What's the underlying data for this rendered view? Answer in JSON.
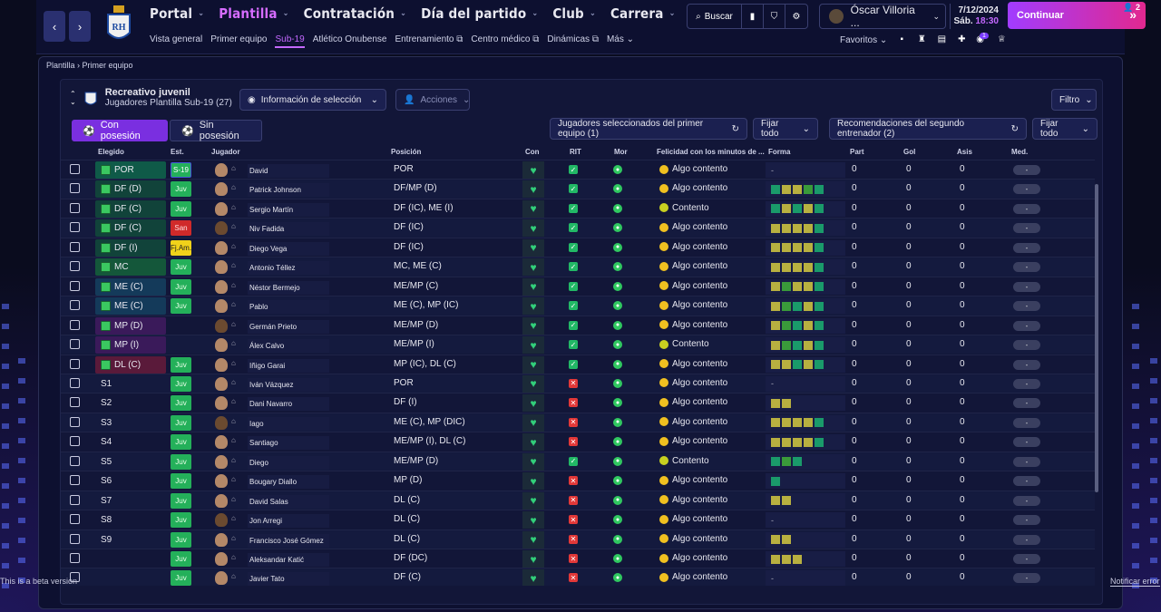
{
  "colors": {
    "accent": "#c468ff",
    "continue_from": "#a13cff",
    "continue_to": "#e2288f",
    "juv": "#24b05a",
    "san": "#d02a2a"
  },
  "nav": {
    "back_icon": "chevron-left-icon",
    "forward_icon": "chevron-right-icon",
    "main": [
      "Portal",
      "Plantilla",
      "Contratación",
      "Día del partido",
      "Club",
      "Carrera"
    ],
    "active_main": "Plantilla",
    "sub": [
      "Vista general",
      "Primer equipo",
      "Sub-19",
      "Atlético Onubense",
      "Entrenamiento",
      "Centro médico",
      "Dinámicas",
      "Más"
    ],
    "active_sub": "Sub-19"
  },
  "search": {
    "label": "Buscar"
  },
  "profile": {
    "name": "Óscar Villoria ..."
  },
  "date": {
    "date": "7/12/2024",
    "day": "Sáb.",
    "time": "18:30"
  },
  "continue": {
    "label": "Continuar",
    "count": "2"
  },
  "favs": {
    "label": "Favoritos",
    "badge": "1"
  },
  "breadcrumb": {
    "a": "Plantilla",
    "b": "Primer equipo"
  },
  "team": {
    "name": "Recreativo juvenil",
    "subtitle": "Jugadores Plantilla Sub-19 (27)"
  },
  "controls": {
    "info": "Información de selección",
    "actions": "Acciones",
    "filter": "Filtro",
    "tab_on": "Con posesión",
    "tab_off": "Sin posesión",
    "selected": "Jugadores seleccionados del primer equipo (1)",
    "fix_all": "Fijar todo",
    "recs": "Recomendaciones del segundo entrenador (2)",
    "fix_all2": "Fijar todo"
  },
  "columns": [
    "Elegido",
    "Est.",
    "Jugador",
    "Posición",
    "Con",
    "RIT",
    "Mor",
    "Felicidad con los minutos de ...",
    "Forma",
    "Part",
    "Gol",
    "Asis",
    "Med."
  ],
  "rows": [
    {
      "sel": "POR",
      "st": "S-19",
      "name": "David",
      "pos": "POR",
      "rit": "ok",
      "fel": "Algo contento",
      "forma": "-",
      "part": "0",
      "gol": "0",
      "asis": "0",
      "med": "-"
    },
    {
      "sel": "DF (D)",
      "st": "Juv",
      "name": "Patrick Johnson",
      "pos": "DF/MP (D)",
      "rit": "ok",
      "fel": "Algo contento",
      "forma": "gyyg g",
      "part": "0",
      "gol": "0",
      "asis": "0",
      "med": "-"
    },
    {
      "sel": "DF (C)",
      "st": "Juv",
      "name": "Sergio Martín",
      "pos": "DF (IC), ME (I)",
      "rit": "ok",
      "fel": "Contento",
      "forma": "gygyg",
      "part": "0",
      "gol": "0",
      "asis": "0",
      "med": "-"
    },
    {
      "sel": "DF (C)",
      "st": "San",
      "name": "Niv Fadida",
      "pos": "DF (IC)",
      "rit": "ok",
      "fel": "Algo contento",
      "forma": "yyyyg",
      "part": "0",
      "gol": "0",
      "asis": "0",
      "med": "-"
    },
    {
      "sel": "DF (I)",
      "st": "Fj.Am.",
      "name": "Diego Vega",
      "pos": "DF (IC)",
      "rit": "ok",
      "fel": "Algo contento",
      "forma": "yyyyg",
      "part": "0",
      "gol": "0",
      "asis": "0",
      "med": "-"
    },
    {
      "sel": "MC",
      "st": "Juv",
      "name": "Antonio Téllez",
      "pos": "MC, ME (C)",
      "rit": "ok",
      "fel": "Algo contento",
      "forma": "yyyyg",
      "part": "0",
      "gol": "0",
      "asis": "0",
      "med": "-"
    },
    {
      "sel": "ME (C)",
      "st": "Juv",
      "name": "Néstor Bermejo",
      "pos": "ME/MP (C)",
      "rit": "ok",
      "fel": "Algo contento",
      "forma": "ygyyg",
      "part": "0",
      "gol": "0",
      "asis": "0",
      "med": "-"
    },
    {
      "sel": "ME (C)",
      "st": "Juv",
      "name": "Pablo",
      "pos": "ME (C), MP (IC)",
      "rit": "ok",
      "fel": "Algo contento",
      "forma": "yggyg",
      "part": "0",
      "gol": "0",
      "asis": "0",
      "med": "-"
    },
    {
      "sel": "MP (D)",
      "st": "",
      "name": "Germán Prieto",
      "pos": "ME/MP (D)",
      "rit": "ok",
      "fel": "Algo contento",
      "forma": "yggyg",
      "part": "0",
      "gol": "0",
      "asis": "0",
      "med": "-"
    },
    {
      "sel": "MP (I)",
      "st": "",
      "name": "Álex Calvo",
      "pos": "ME/MP (I)",
      "rit": "ok",
      "fel": "Contento",
      "forma": "yggyg",
      "part": "0",
      "gol": "0",
      "asis": "0",
      "med": "-"
    },
    {
      "sel": "DL (C)",
      "st": "Juv",
      "name": "Iñigo Garai",
      "pos": "MP (IC), DL (C)",
      "rit": "ok",
      "fel": "Algo contento",
      "forma": "yygyg",
      "part": "0",
      "gol": "0",
      "asis": "0",
      "med": "-"
    },
    {
      "sel": "S1",
      "st": "Juv",
      "name": "Iván Vázquez",
      "pos": "POR",
      "rit": "no",
      "fel": "Algo contento",
      "forma": "-",
      "part": "0",
      "gol": "0",
      "asis": "0",
      "med": "-"
    },
    {
      "sel": "S2",
      "st": "Juv",
      "name": "Dani Navarro",
      "pos": "DF (I)",
      "rit": "no",
      "fel": "Algo contento",
      "forma": "yy",
      "part": "0",
      "gol": "0",
      "asis": "0",
      "med": "-"
    },
    {
      "sel": "S3",
      "st": "Juv",
      "name": "Iago",
      "pos": "ME (C), MP (DIC)",
      "rit": "no",
      "fel": "Algo contento",
      "forma": "yyyyg",
      "part": "0",
      "gol": "0",
      "asis": "0",
      "med": "-"
    },
    {
      "sel": "S4",
      "st": "Juv",
      "name": "Santiago",
      "pos": "ME/MP (I), DL (C)",
      "rit": "no",
      "fel": "Algo contento",
      "forma": "yyyyg",
      "part": "0",
      "gol": "0",
      "asis": "0",
      "med": "-"
    },
    {
      "sel": "S5",
      "st": "Juv",
      "name": "Diego",
      "pos": "ME/MP (D)",
      "rit": "ok",
      "fel": "Contento",
      "forma": "ggg",
      "part": "0",
      "gol": "0",
      "asis": "0",
      "med": "-"
    },
    {
      "sel": "S6",
      "st": "Juv",
      "name": "Bougary Diallo",
      "pos": "MP (D)",
      "rit": "no",
      "fel": "Algo contento",
      "forma": "g",
      "part": "0",
      "gol": "0",
      "asis": "0",
      "med": "-"
    },
    {
      "sel": "S7",
      "st": "Juv",
      "name": "David Salas",
      "pos": "DL (C)",
      "rit": "no",
      "fel": "Algo contento",
      "forma": "yy",
      "part": "0",
      "gol": "0",
      "asis": "0",
      "med": "-"
    },
    {
      "sel": "S8",
      "st": "Juv",
      "name": "Jon Arregi",
      "pos": "DL (C)",
      "rit": "no",
      "fel": "Algo contento",
      "forma": "-",
      "part": "0",
      "gol": "0",
      "asis": "0",
      "med": "-"
    },
    {
      "sel": "S9",
      "st": "Juv",
      "name": "Francisco José Gómez",
      "pos": "DL (C)",
      "rit": "no",
      "fel": "Algo contento",
      "forma": "yy",
      "part": "0",
      "gol": "0",
      "asis": "0",
      "med": "-"
    },
    {
      "sel": "",
      "st": "Juv",
      "name": "Aleksandar Katić",
      "pos": "DF (DC)",
      "rit": "no",
      "fel": "Algo contento",
      "forma": "yyy",
      "part": "0",
      "gol": "0",
      "asis": "0",
      "med": "-"
    },
    {
      "sel": "",
      "st": "Juv",
      "name": "Javier Tato",
      "pos": "DF (C)",
      "rit": "no",
      "fel": "Algo contento",
      "forma": "-",
      "part": "0",
      "gol": "0",
      "asis": "0",
      "med": "-"
    }
  ],
  "footer": {
    "beta": "This is a beta version",
    "notify": "Notificar error"
  }
}
